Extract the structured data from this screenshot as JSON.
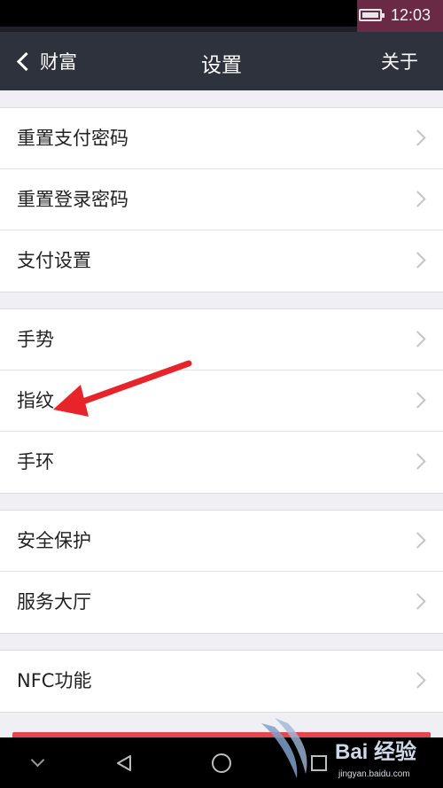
{
  "status_bar": {
    "time": "12:03",
    "battery_icon": "battery-full-icon"
  },
  "nav": {
    "back_label": "财富",
    "title": "设置",
    "about_label": "关于"
  },
  "groups": [
    {
      "items": [
        {
          "label": "重置支付密码"
        },
        {
          "label": "重置登录密码"
        },
        {
          "label": "支付设置"
        }
      ]
    },
    {
      "items": [
        {
          "label": "手势"
        },
        {
          "label": "指纹"
        },
        {
          "label": "手环"
        }
      ]
    },
    {
      "items": [
        {
          "label": "安全保护"
        },
        {
          "label": "服务大厅"
        }
      ]
    },
    {
      "items": [
        {
          "label": "NFC功能"
        }
      ]
    }
  ],
  "colors": {
    "nav_background": "#2e323d",
    "page_background": "#efeff4",
    "annotation_arrow": "#e8242b",
    "logout_strip": "#e4454f"
  },
  "watermark": {
    "brand": "Bai 经验",
    "url": "jingyan.baidu.com"
  }
}
